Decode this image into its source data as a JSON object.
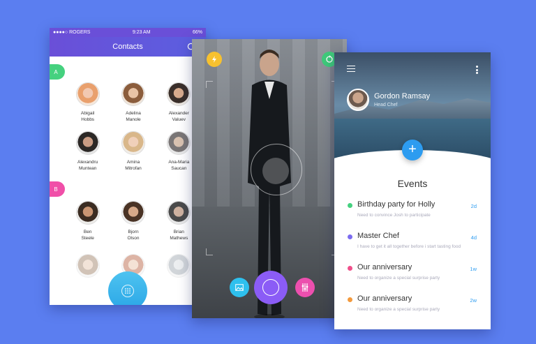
{
  "contacts": {
    "status": {
      "carrier": "●●●●○ ROGERS",
      "time": "9:23 AM",
      "battery": "66%"
    },
    "title": "Contacts",
    "sections": [
      {
        "letter": "A",
        "people": [
          "Abigail\nHobbs",
          "Adelina\nManole",
          "Alexander\nValuev",
          "Alexandru\nMuntean",
          "Amina\nMitrofan",
          "Ana-Maria\nSaucan"
        ]
      },
      {
        "letter": "B",
        "people": [
          "Ben\nSteele",
          "Bjorn\nOlson",
          "Brian\nMathews"
        ]
      }
    ],
    "colors": {
      "header": "#6a4fd8",
      "tab_a": "#45d17f",
      "tab_b": "#f04fa8",
      "fab": "#3cb6ee"
    }
  },
  "camera": {
    "buttons": [
      "flash-icon",
      "rotate-camera-icon",
      "gallery-icon",
      "shutter-button",
      "filters-icon"
    ],
    "colors": {
      "flash": "#f7c12f",
      "rotate": "#3fcb7a",
      "gallery": "#2ec0ee",
      "shutter": "#8b5cf6",
      "filters": "#ec4fae"
    }
  },
  "events": {
    "user": {
      "name": "Gordon Ramsay",
      "role": "Head Chef"
    },
    "heading": "Events",
    "items": [
      {
        "title": "Birthday party for Holly",
        "desc": "Need to convince Josh to participate",
        "time": "2d",
        "color": "#45d17f"
      },
      {
        "title": "Master Chef",
        "desc": "I have to get it all together before i start tasting food",
        "time": "4d",
        "color": "#7c6cf0"
      },
      {
        "title": "Our anniversary",
        "desc": "Need to organize a special surprise party",
        "time": "1w",
        "color": "#f04f8a"
      },
      {
        "title": "Our anniversary",
        "desc": "Need to organize a special surprise party",
        "time": "2w",
        "color": "#f39a3d"
      }
    ]
  }
}
